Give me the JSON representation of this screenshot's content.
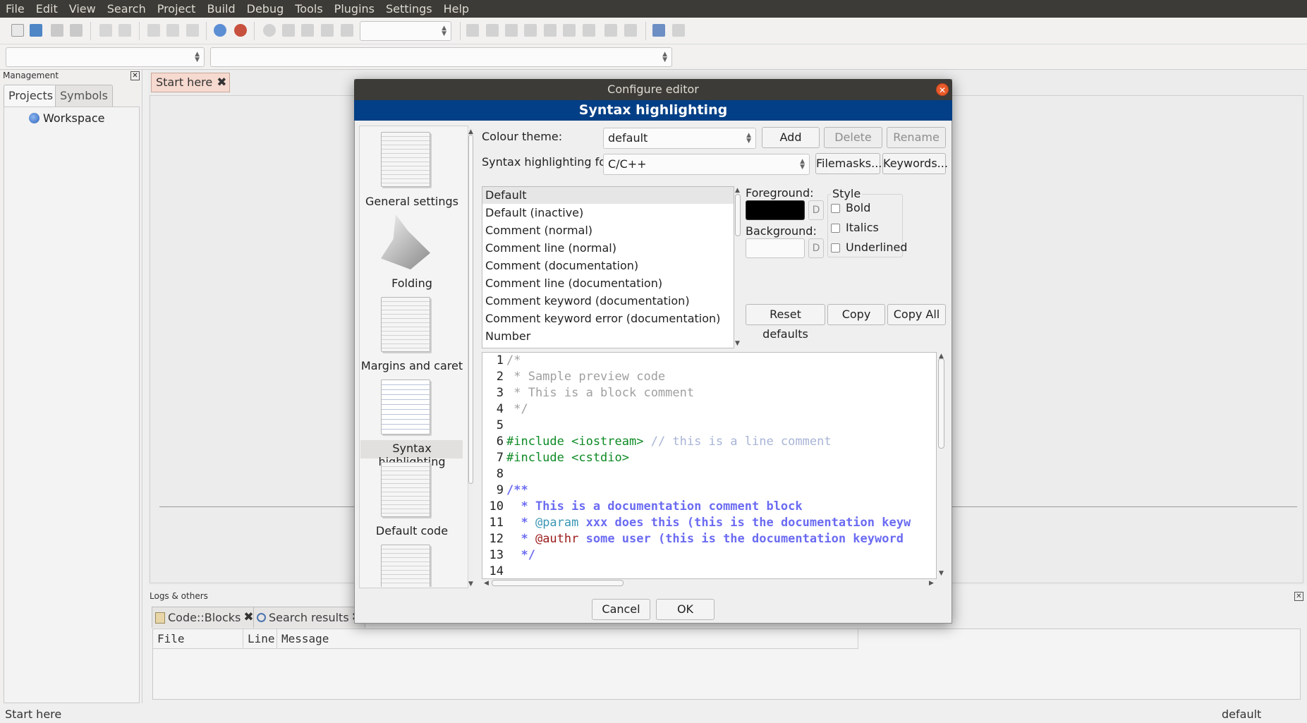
{
  "menubar": [
    "File",
    "Edit",
    "View",
    "Search",
    "Project",
    "Build",
    "Debug",
    "Tools",
    "Plugins",
    "Settings",
    "Help"
  ],
  "management": {
    "title": "Management",
    "tabs": [
      "Projects",
      "Symbols"
    ],
    "workspace": "Workspace"
  },
  "editor": {
    "tab": "Start here"
  },
  "logs": {
    "title": "Logs & others",
    "tabs": [
      "Code::Blocks",
      "Search results"
    ],
    "columns": [
      "File",
      "Line",
      "Message"
    ]
  },
  "status": {
    "left": "Start here",
    "right": "default"
  },
  "dialog": {
    "title": "Configure editor",
    "header": "Syntax highlighting",
    "categories": [
      "General settings",
      "Folding",
      "Margins and caret",
      "Syntax highlighting",
      "Default code"
    ],
    "colour_theme_label": "Colour theme:",
    "colour_theme_value": "default",
    "add": "Add",
    "delete": "Delete",
    "rename": "Rename",
    "syntax_for_label": "Syntax highlighting for:",
    "syntax_for_value": "C/C++",
    "filemasks": "Filemasks...",
    "keywords": "Keywords...",
    "styles": [
      "Default",
      "Default (inactive)",
      "Comment (normal)",
      "Comment line (normal)",
      "Comment (documentation)",
      "Comment line (documentation)",
      "Comment keyword (documentation)",
      "Comment keyword error (documentation)",
      "Number"
    ],
    "foreground_label": "Foreground:",
    "background_label": "Background:",
    "d": "D",
    "style_label": "Style",
    "bold": "Bold",
    "italics": "Italics",
    "underlined": "Underlined",
    "reset_defaults": "Reset defaults",
    "copy": "Copy",
    "copy_all": "Copy All",
    "cancel": "Cancel",
    "ok": "OK",
    "preview": {
      "line_numbers": [
        "1",
        "2",
        "3",
        "4",
        "5",
        "6",
        "7",
        "8",
        "9",
        "10",
        "11",
        "12",
        "13",
        "14"
      ],
      "l1": "/*",
      "l2": " * Sample preview code",
      "l3": " * This is a block comment",
      "l4": " */",
      "l6a": "#include <iostream>",
      "l6b": " // this is a line comment",
      "l7": "#include <cstdio>",
      "l9": "/**",
      "l10": "  * This is a documentation comment block",
      "l11a": "  * ",
      "l11b": "@param",
      "l11c": " xxx does this (this is the documentation keyw",
      "l12a": "  * ",
      "l12b": "@authr",
      "l12c": " some user (this is the documentation keyword",
      "l13": "  */"
    }
  },
  "colors": {
    "dialog_header": "#033f86",
    "menubar": "#3c3b37",
    "close_button": "#e95b2a"
  }
}
